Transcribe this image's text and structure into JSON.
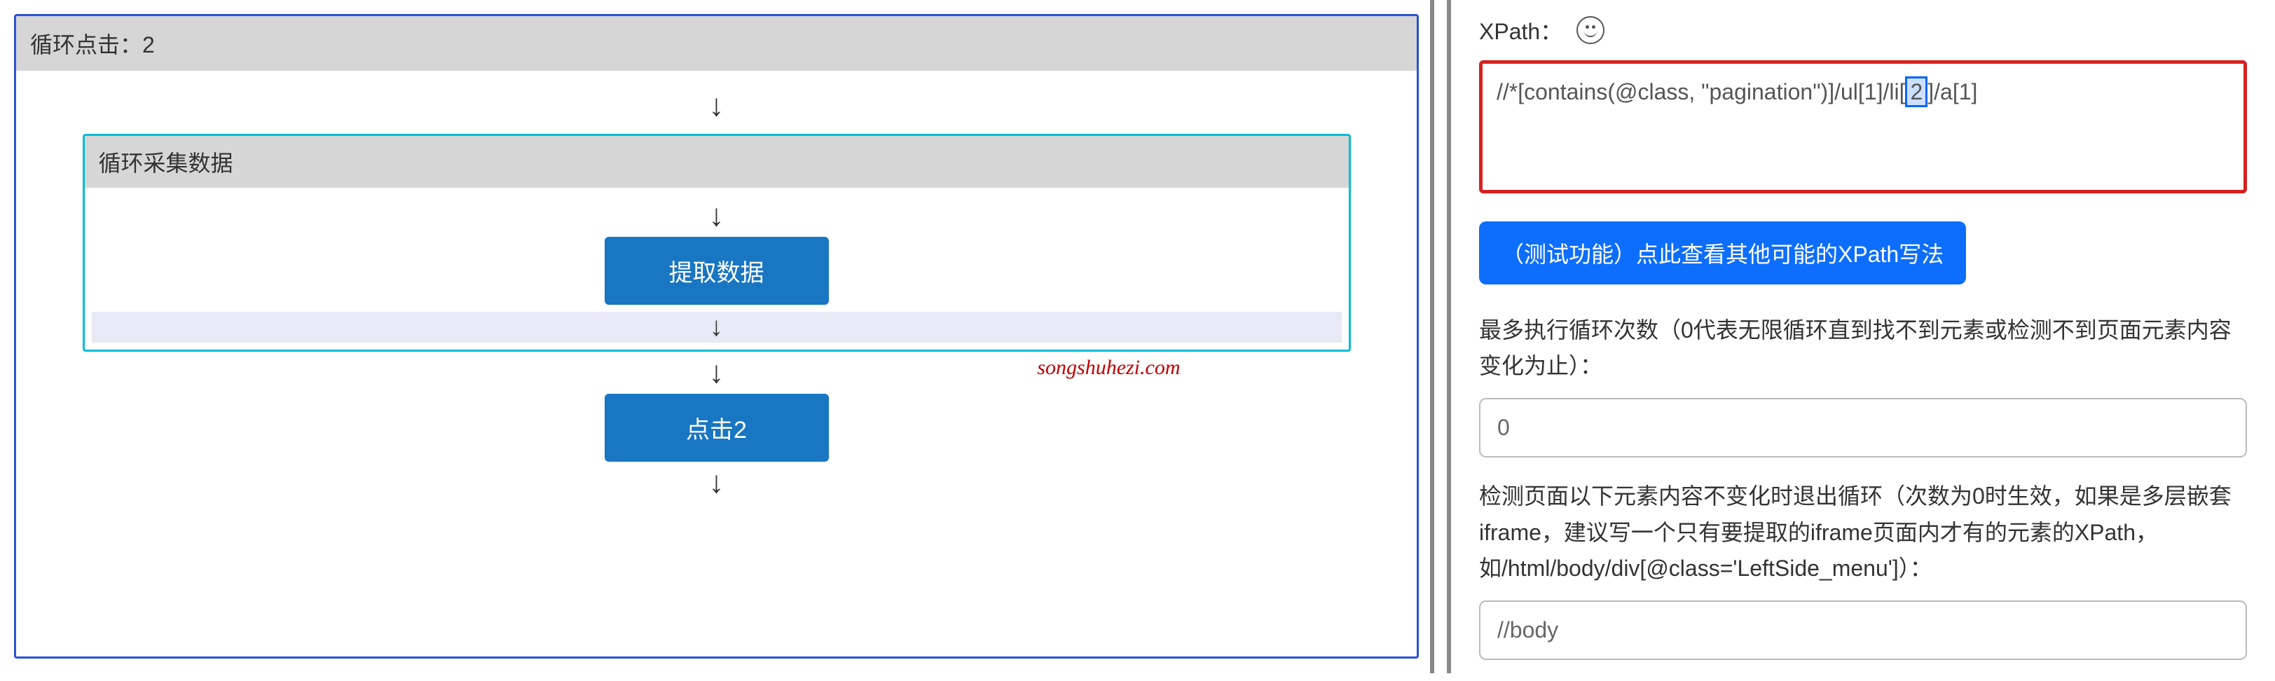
{
  "left": {
    "outer_header": "循环点击：2",
    "inner_header": "循环采集数据",
    "extract_btn": "提取数据",
    "click_btn": "点击2",
    "watermark": "songshuhezi.com"
  },
  "right": {
    "xpath_label": "XPath：",
    "xpath_prefix": "//*[contains(@class, \"pagination\")]/ul[1]/li[",
    "xpath_highlight": "2",
    "xpath_suffix": "]/a[1]",
    "test_btn": "（测试功能）点此查看其他可能的XPath写法",
    "max_loop_label": "最多执行循环次数（0代表无限循环直到找不到元素或检测不到页面元素内容变化为止）：",
    "max_loop_value": "0",
    "detect_label": "检测页面以下元素内容不变化时退出循环（次数为0时生效，如果是多层嵌套iframe，建议写一个只有要提取的iframe页面内才有的元素的XPath，如/html/body/div[@class='LeftSide_menu']）：",
    "detect_value": "//body"
  }
}
